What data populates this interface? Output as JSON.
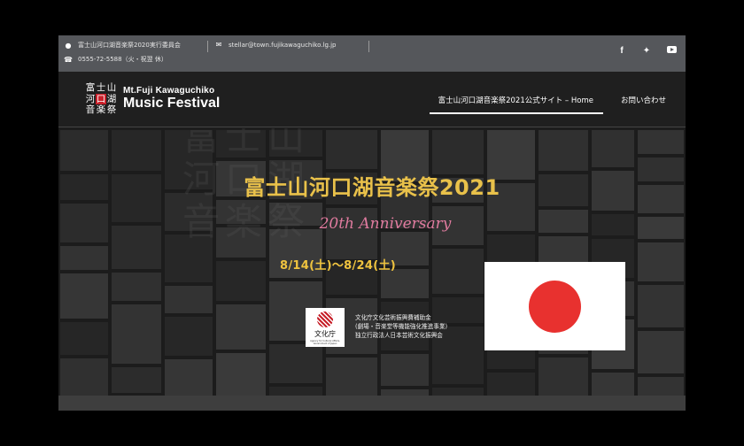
{
  "topbar": {
    "committee": "富士山河口湖音楽祭2020実行委員会",
    "phone": "0555-72-5588（火・祝翌 休）",
    "email": "stellar@town.fujikawaguchiko.lg.jp",
    "social": [
      "facebook-icon",
      "twitter-icon",
      "youtube-icon"
    ],
    "icons": {
      "location": "map-pin-icon",
      "phone": "phone-icon",
      "email": "envelope-icon"
    }
  },
  "logo": {
    "kanji_row1": [
      "富",
      "士",
      "山"
    ],
    "kanji_row2": [
      "河",
      "口",
      "湖"
    ],
    "kanji_row3": [
      "音",
      "楽",
      "祭"
    ],
    "line1": "Mt.Fuji Kawaguchiko",
    "line2": "Music Festival"
  },
  "nav": {
    "home": "富士山河口湖音楽祭2021公式サイト – Home",
    "contact": "お問い合わせ"
  },
  "hero": {
    "bg_kanji": "富士山\n河口湖\n音楽祭",
    "title": "富士山河口湖音楽祭2021",
    "anniversary": "20th Anniversary",
    "dates": "8/14(土)〜8/24(土)",
    "bunka_logo_jp": "文化庁",
    "bunka_logo_en": "Agency for Cultural Affairs, Government of Japan",
    "support_line1": "文化庁文化芸術振興費補助金",
    "support_line2": "(劇場・音楽堂等機能強化推進事業)",
    "support_line3": "独立行政法人日本芸術文化振興会"
  },
  "colors": {
    "title": "#e9c14a",
    "anniversary": "#e07b9f",
    "topbar": "#55575b",
    "flag_red": "#e8312f"
  }
}
